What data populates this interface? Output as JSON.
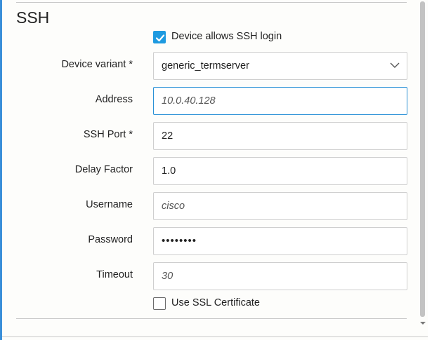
{
  "section": {
    "title": "SSH"
  },
  "ssh_login": {
    "label": "Device allows SSH login",
    "checked": true
  },
  "fields": {
    "device_variant": {
      "label": "Device variant *",
      "value": "generic_termserver"
    },
    "address": {
      "label": "Address",
      "placeholder": "10.0.40.128"
    },
    "ssh_port": {
      "label": "SSH Port *",
      "value": "22"
    },
    "delay_factor": {
      "label": "Delay Factor",
      "value": "1.0"
    },
    "username": {
      "label": "Username",
      "placeholder": "cisco"
    },
    "password": {
      "label": "Password",
      "value": "••••••••"
    },
    "timeout": {
      "label": "Timeout",
      "placeholder": "30"
    }
  },
  "ssl_cert": {
    "label": "Use SSL Certificate",
    "checked": false
  },
  "colors": {
    "accent": "#1e9ae0",
    "focus_border": "#2a91d6",
    "frame_left": "#3a8fd9"
  }
}
